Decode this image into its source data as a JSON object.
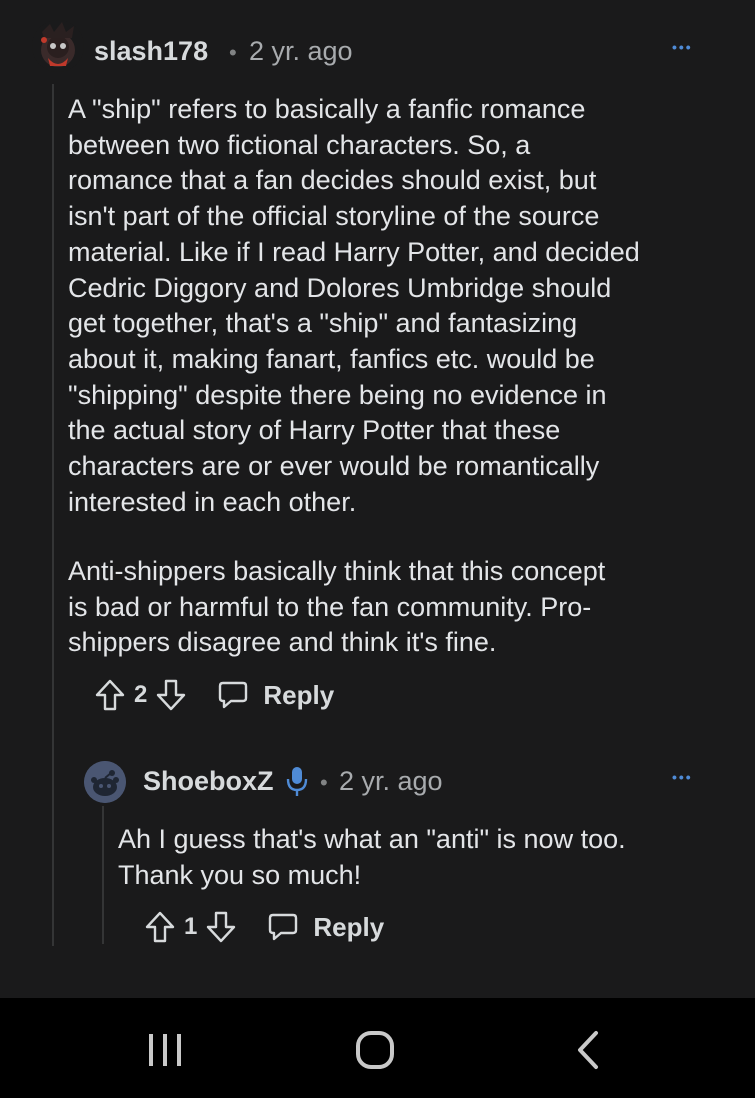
{
  "comment": {
    "username": "slash178",
    "separator": "•",
    "time": "2 yr. ago",
    "more_label": "•••",
    "body_p1": "A \"ship\" refers to basically a fanfic romance\nbetween two fictional characters. So, a\nromance that a fan decides should exist, but\nisn't part of the official storyline of the source\nmaterial. Like if I read Harry Potter, and decided\nCedric Diggory and Dolores Umbridge should\nget together, that's a \"ship\" and fantasizing\nabout it, making fanart, fanfics etc. would be\n\"shipping\" despite there being no evidence in\nthe actual story of Harry Potter that these\ncharacters are or ever would be romantically\ninterested in each other.",
    "body_p2": "Anti-shippers basically think that this concept\nis bad or harmful to the fan community. Pro-\nshippers disagree and think it's fine.",
    "votes": "2",
    "reply_label": "Reply"
  },
  "reply": {
    "username": "ShoeboxZ",
    "separator": "•",
    "time": "2 yr. ago",
    "more_label": "•••",
    "body": "Ah I guess that's what an \"anti\" is now too.\nThank you so much!",
    "votes": "1",
    "reply_label": "Reply"
  },
  "colors": {
    "background": "#1a1a1b",
    "text": "#d7dadc",
    "accent": "#4f8bd6",
    "navbar": "#000000"
  },
  "icons": [
    "upvote-icon",
    "downvote-icon",
    "reply-icon",
    "more-icon",
    "mic-icon",
    "recents-icon",
    "home-icon",
    "back-icon"
  ]
}
